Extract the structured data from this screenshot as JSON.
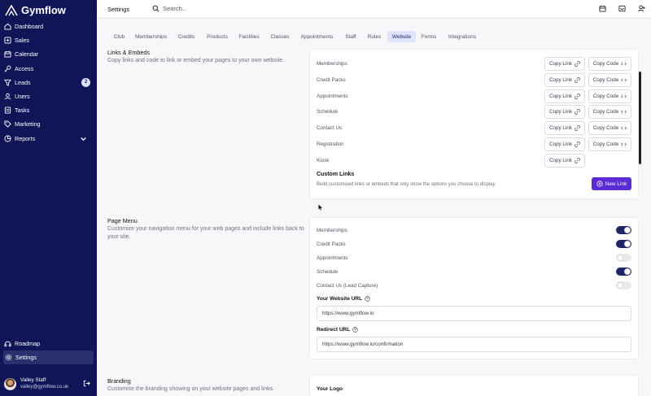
{
  "brand": {
    "name": "Gymflow"
  },
  "sidebar": {
    "items": [
      {
        "label": "Dashboard",
        "icon": "home-icon"
      },
      {
        "label": "Sales",
        "icon": "sales-icon"
      },
      {
        "label": "Calendar",
        "icon": "calendar-icon"
      },
      {
        "label": "Access",
        "icon": "key-icon"
      },
      {
        "label": "Leads",
        "icon": "filter-icon",
        "badge": "2"
      },
      {
        "label": "Users",
        "icon": "users-icon"
      },
      {
        "label": "Tasks",
        "icon": "tasks-icon"
      },
      {
        "label": "Marketing",
        "icon": "tag-icon"
      },
      {
        "label": "Reports",
        "icon": "chart-icon"
      }
    ],
    "bottom": [
      {
        "label": "Roadmap",
        "icon": "roadmap-icon"
      },
      {
        "label": "Settings",
        "icon": "gear-icon"
      }
    ],
    "user": {
      "name": "Valley Staff",
      "email": "valley@gymflow.co.uk"
    }
  },
  "topbar": {
    "title": "Settings",
    "search_placeholder": "Search..."
  },
  "tabs": [
    "Club",
    "Memberships",
    "Credits",
    "Products",
    "Facilities",
    "Classes",
    "Appointments",
    "Staff",
    "Rules",
    "Website",
    "Forms",
    "Integrations"
  ],
  "active_tab": "Website",
  "links": {
    "title": "Links & Embeds",
    "description": "Copy links and code to link or embed your pages to your own website.",
    "rows": [
      {
        "label": "Memberships",
        "link": "Copy Link",
        "code": "Copy Code"
      },
      {
        "label": "Credit Packs",
        "link": "Copy Link",
        "code": "Copy Code"
      },
      {
        "label": "Appointments",
        "link": "Copy Link",
        "code": "Copy Code"
      },
      {
        "label": "Schedule",
        "link": "Copy Link",
        "code": "Copy Code"
      },
      {
        "label": "Contact Us",
        "link": "Copy Link",
        "code": "Copy Code"
      },
      {
        "label": "Registration",
        "link": "Copy Link",
        "code": "Copy Code"
      },
      {
        "label": "Kiosk",
        "link": "Copy Link"
      }
    ],
    "custom_title": "Custom Links",
    "custom_hint": "Build customised links or embeds that only show the options you choose to display.",
    "new_link": "New Link"
  },
  "menu": {
    "title": "Page Menu",
    "description": "Customize your navigation menu for your web pages and include links back to your site.",
    "toggles": [
      {
        "label": "Memberships",
        "on": true
      },
      {
        "label": "Credit Packs",
        "on": true
      },
      {
        "label": "Appointments",
        "on": false
      },
      {
        "label": "Schedule",
        "on": true
      },
      {
        "label": "Contact Us (Lead Capture)",
        "on": false
      }
    ],
    "website_url_label": "Your Website URL",
    "website_url": "https://www.gymflow.io",
    "redirect_label": "Redirect URL",
    "redirect_url": "https://www.gymflow.io/confirmation"
  },
  "branding": {
    "title": "Branding",
    "description": "Customise the branding showing on your website pages and links.",
    "logo_label": "Your Logo"
  },
  "colors": {
    "sidebar": "#0f1557",
    "accent": "#5b2bd6",
    "toggle_on": "#1d2566"
  }
}
